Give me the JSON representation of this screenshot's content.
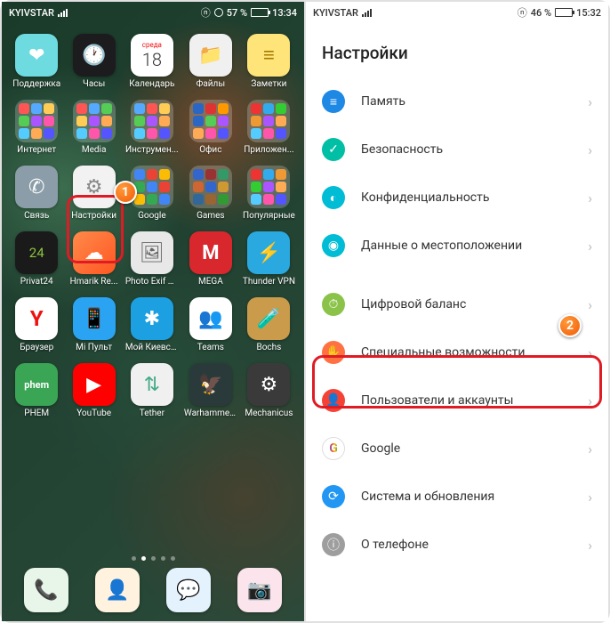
{
  "left": {
    "status": {
      "carrier": "KYIVSTAR",
      "battery": "57 %",
      "time": "13:34"
    },
    "rows": [
      [
        {
          "type": "icon",
          "label": "Поддержка",
          "bg": "#6edbe0",
          "glyph": "❤"
        },
        {
          "type": "icon",
          "label": "Часы",
          "bg": "#1c1c1e",
          "glyph": "🕐"
        },
        {
          "type": "icon",
          "label": "Календарь",
          "bg": "#ffffff",
          "glyph": "18",
          "text": "#333",
          "top": "среда"
        },
        {
          "type": "icon",
          "label": "Файлы",
          "bg": "#f0f0f0",
          "glyph": "📁"
        },
        {
          "type": "icon",
          "label": "Заметки",
          "bg": "#ffe47a",
          "glyph": "≡",
          "text": "#a67b00"
        }
      ],
      [
        {
          "type": "folder",
          "label": "Интернет",
          "colors": [
            "#f55",
            "#5af",
            "#fc5",
            "#5c5",
            "#a5f",
            "#f5a",
            "#5cf",
            "#fa5",
            "#55f"
          ]
        },
        {
          "type": "folder",
          "label": "Media",
          "colors": [
            "#f55",
            "#5af",
            "#5c5",
            "#fc5",
            "#a5f",
            "#fa5",
            "#5cf",
            "#f5a",
            "#55f"
          ]
        },
        {
          "type": "folder",
          "label": "Инструмен...",
          "colors": [
            "#5af",
            "#f55",
            "#fc5",
            "#5c5",
            "#a5f",
            "#fa5",
            "#5cf",
            "#f5a",
            "#55f"
          ]
        },
        {
          "type": "folder",
          "label": "Офис",
          "colors": [
            "#2a66c4",
            "#d33",
            "#f90",
            "#2a66c4",
            "#5c5",
            "#a5f",
            "#fa5",
            "#f5a",
            "#55f"
          ]
        },
        {
          "type": "folder",
          "label": "Приложен...",
          "colors": [
            "#e33",
            "#3ae",
            "#3c3",
            "#e93",
            "#a5f",
            "#fa5",
            "#5cf",
            "#f5a",
            "#55f"
          ]
        }
      ],
      [
        {
          "type": "icon",
          "label": "Связь",
          "bg": "#8b9da8",
          "glyph": "✆"
        },
        {
          "type": "icon",
          "label": "Настройки",
          "bg": "#f2f2f2",
          "glyph": "⚙",
          "text": "#888",
          "highlight": true
        },
        {
          "type": "folder",
          "label": "Google",
          "colors": [
            "#4285f4",
            "#ea4335",
            "#fbbc05",
            "#34a853",
            "#4285f4",
            "#ea4335",
            "#fbbc05",
            "#34a853",
            "#4285f4"
          ]
        },
        {
          "type": "folder",
          "label": "Games",
          "colors": [
            "#36c",
            "#933",
            "#396",
            "#c63",
            "#36c",
            "#c93",
            "#369",
            "#963",
            "#393"
          ]
        },
        {
          "type": "folder",
          "label": "Популярные",
          "colors": [
            "#e33",
            "#3ae",
            "#e93",
            "#3c3",
            "#a5f",
            "#fa5",
            "#5cf",
            "#f5a",
            "#55f"
          ]
        }
      ],
      [
        {
          "type": "icon",
          "label": "Privat24",
          "bg": "#1a1a1a",
          "glyph": "24",
          "text": "#8cc63f",
          "fontSize": "15px"
        },
        {
          "type": "icon",
          "label": "Hmarik Re...",
          "bg": "linear-gradient(135deg,#ff8a4a,#ff5722)",
          "glyph": "☁"
        },
        {
          "type": "icon",
          "label": "Photo Exif E...",
          "bg": "#e8e8e8",
          "glyph": "🖼",
          "text": "#666"
        },
        {
          "type": "icon",
          "label": "MEGA",
          "bg": "#d9272e",
          "glyph": "M",
          "fontSize": "22px",
          "bold": true
        },
        {
          "type": "icon",
          "label": "Thunder VPN",
          "bg": "#2aa9e0",
          "glyph": "⚡"
        }
      ],
      [
        {
          "type": "icon",
          "label": "Браузер",
          "bg": "#ffffff",
          "glyph": "Y",
          "text": "#e11",
          "bold": true,
          "fontSize": "24px"
        },
        {
          "type": "icon",
          "label": "Mi Пульт",
          "bg": "#2aa4f2",
          "glyph": "📱"
        },
        {
          "type": "icon",
          "label": "Мой Киевст...",
          "bg": "#1da0e2",
          "glyph": "✱"
        },
        {
          "type": "icon",
          "label": "Teams",
          "bg": "#ffffff",
          "glyph": "👥",
          "text": "#4b53bc"
        },
        {
          "type": "icon",
          "label": "Bochs",
          "bg": "#c99b4a",
          "glyph": "🧪"
        }
      ],
      [
        {
          "type": "icon",
          "label": "PHEM",
          "bg": "#3aa655",
          "glyph": "phem",
          "fontSize": "11px",
          "bold": true
        },
        {
          "type": "icon",
          "label": "YouTube",
          "bg": "#ff0000",
          "glyph": "▶"
        },
        {
          "type": "icon",
          "label": "Tether",
          "bg": "#f0f0f0",
          "glyph": "⇅",
          "text": "#4a8"
        },
        {
          "type": "icon",
          "label": "Warhammer...",
          "bg": "#2a3a3a",
          "glyph": "🦅"
        },
        {
          "type": "icon",
          "label": "Mechanicus",
          "bg": "#3a3a3a",
          "glyph": "⚙"
        }
      ]
    ],
    "dock": [
      {
        "bg": "#e8f5e9",
        "glyph": "📞",
        "text": "#3aa655",
        "name": "phone"
      },
      {
        "bg": "#fff3e0",
        "glyph": "👤",
        "text": "#ff9800",
        "name": "contacts"
      },
      {
        "bg": "#e3f2fd",
        "glyph": "💬",
        "text": "#2196f3",
        "name": "messages"
      },
      {
        "bg": "#fce4ec",
        "glyph": "📷",
        "text": "#e91e63",
        "name": "camera"
      }
    ]
  },
  "right": {
    "status": {
      "carrier": "KYIVSTAR",
      "battery": "46 %",
      "time": "15:32"
    },
    "title": "Настройки",
    "groups": [
      [
        {
          "icon": "storage",
          "color": "#1e88e5",
          "label": "Память"
        },
        {
          "icon": "shield",
          "color": "#00bfa5",
          "label": "Безопасность"
        },
        {
          "icon": "privacy",
          "color": "#00bcd4",
          "label": "Конфиденциальность"
        },
        {
          "icon": "location",
          "color": "#00bcd4",
          "label": "Данные о местоположении"
        }
      ],
      [
        {
          "icon": "balance",
          "color": "#8bc34a",
          "label": "Цифровой баланс"
        },
        {
          "icon": "accessibility",
          "color": "#ff7043",
          "label": "Специальные возможности",
          "highlight": true
        },
        {
          "icon": "users",
          "color": "#f44336",
          "label": "Пользователи и аккаунты"
        },
        {
          "icon": "google",
          "color": "#ffffff",
          "label": "Google",
          "multicolor": true
        },
        {
          "icon": "system",
          "color": "#2196f3",
          "label": "Система и обновления"
        },
        {
          "icon": "about",
          "color": "#9e9e9e",
          "label": "О телефоне"
        }
      ]
    ]
  }
}
